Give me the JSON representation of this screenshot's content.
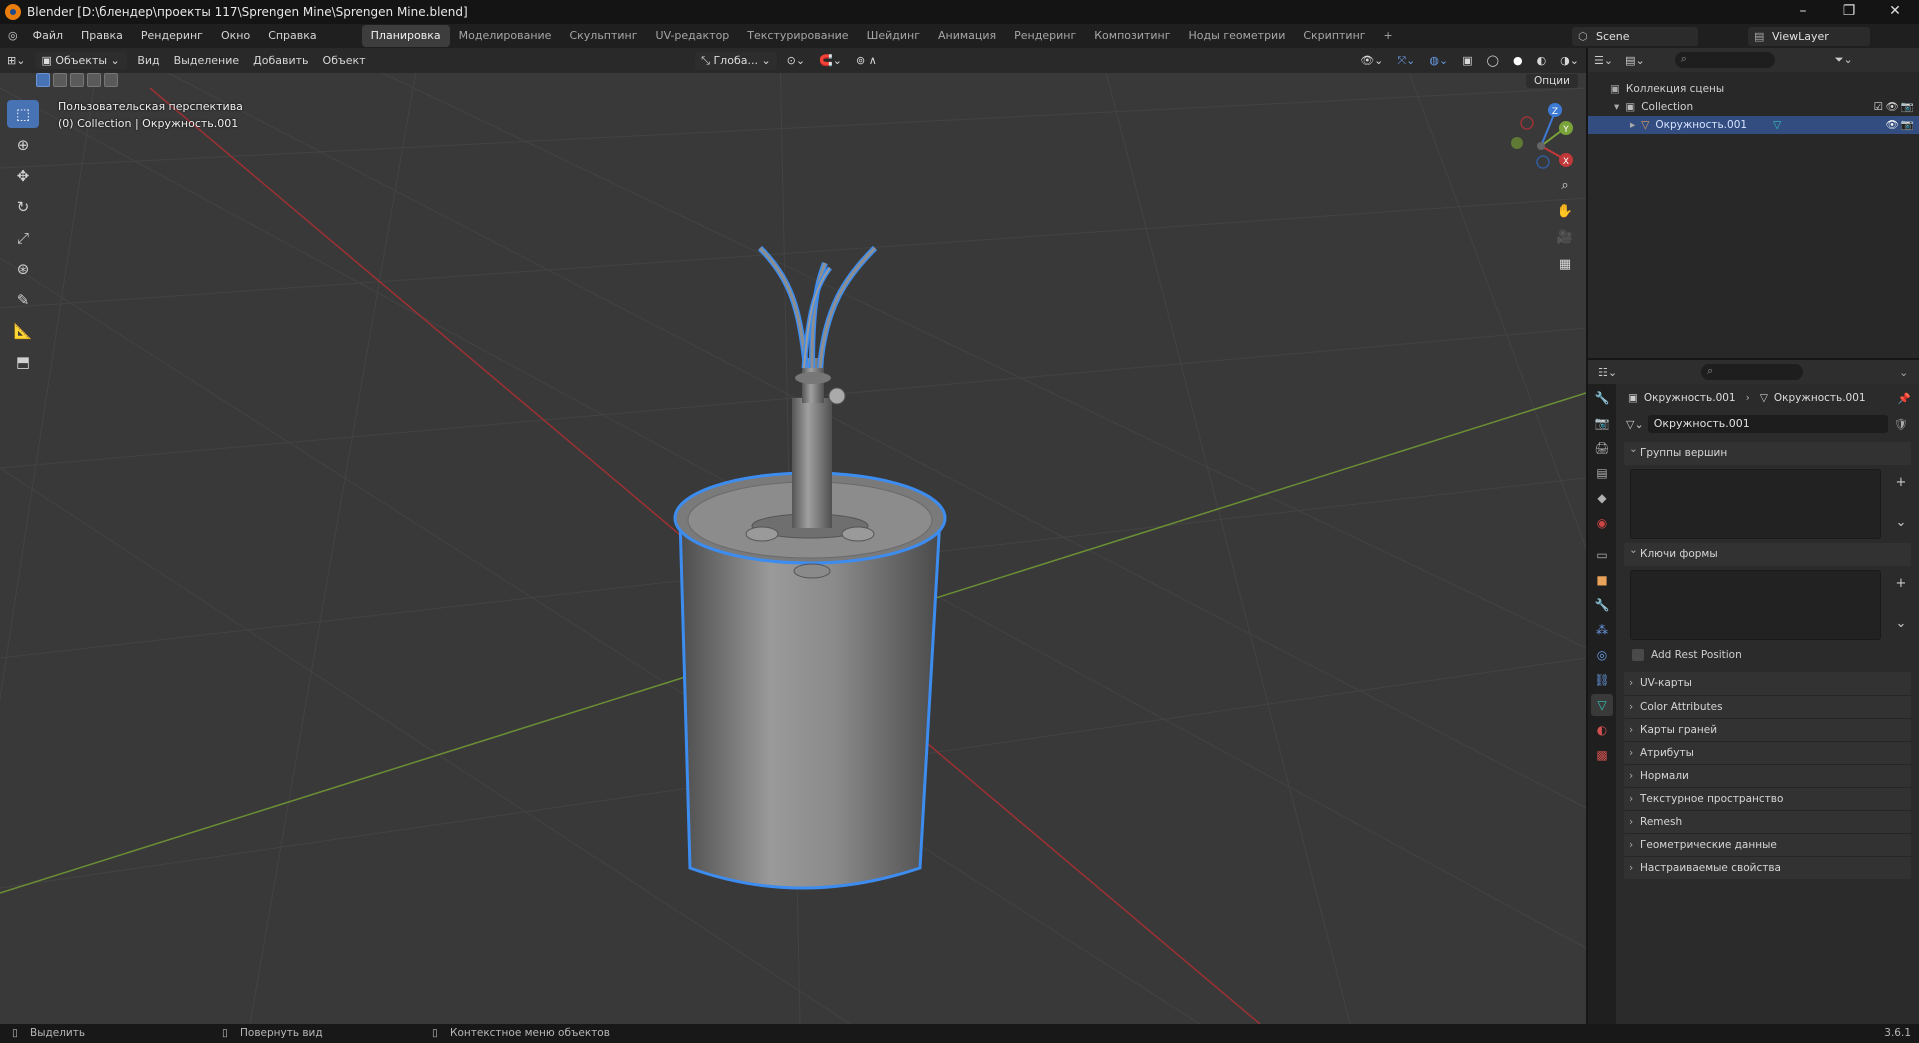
{
  "window": {
    "title": "Blender [D:\\блендер\\проекты 117\\Sprengen Mine\\Sprengen Mine.blend]"
  },
  "menu": {
    "items": [
      "Файл",
      "Правка",
      "Рендеринг",
      "Окно",
      "Справка"
    ]
  },
  "workspaces": {
    "tabs": [
      "Планировка",
      "Моделирование",
      "Скульптинг",
      "UV-редактор",
      "Текстурирование",
      "Шейдинг",
      "Анимация",
      "Рендеринг",
      "Композитинг",
      "Ноды геометрии",
      "Скриптинг"
    ],
    "active": "Планировка",
    "add": "+"
  },
  "scene": {
    "name": "Scene",
    "view_layer": "ViewLayer"
  },
  "viewport": {
    "mode": "Объекты",
    "menus": [
      "Вид",
      "Выделение",
      "Добавить",
      "Объект"
    ],
    "orientation": "Глоба...",
    "options": "Опции",
    "perspective": "Пользовательская перспектива",
    "context": "(0) Collection | Окружность.001",
    "gizmo": {
      "x": "X",
      "y": "Y",
      "z": "Z"
    }
  },
  "outliner": {
    "scene_collection": "Коллекция сцены",
    "collection": "Collection",
    "object": "Окружность.001"
  },
  "properties": {
    "breadcrumb_object": "Окружность.001",
    "breadcrumb_mesh": "Окружность.001",
    "mesh_name": "Окружность.001",
    "vertex_groups": "Группы вершин",
    "shape_keys": "Ключи формы",
    "add_rest_position": "Add Rest Position",
    "panels": [
      "UV-карты",
      "Color Attributes",
      "Карты граней",
      "Атрибуты",
      "Нормали",
      "Текстурное пространство",
      "Remesh",
      "Геометрические данные",
      "Настраиваемые свойства"
    ]
  },
  "status": {
    "select": "Выделить",
    "rotate": "Повернуть вид",
    "context_menu": "Контекстное меню объектов",
    "version": "3.6.1"
  },
  "colors": {
    "accent": "#4772b3",
    "selection_outline": "#3d8cf0",
    "x_axis": "#c0383a",
    "y_axis": "#7aa33a",
    "z_axis": "#3d7ad6"
  }
}
